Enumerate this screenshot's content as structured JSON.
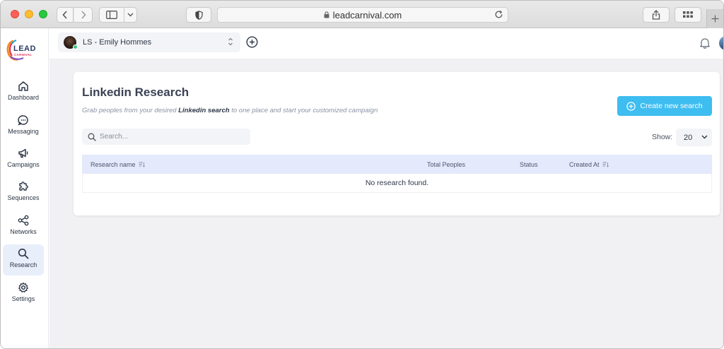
{
  "browser": {
    "url": "leadcarnival.com"
  },
  "logo": {
    "text_top": "LEAD",
    "text_bottom": "CARNIVAL"
  },
  "sidebar": {
    "items": [
      {
        "label": "Dashboard",
        "icon": "home-icon",
        "active": false
      },
      {
        "label": "Messaging",
        "icon": "chat-icon",
        "active": false
      },
      {
        "label": "Campaigns",
        "icon": "megaphone-icon",
        "active": false
      },
      {
        "label": "Sequences",
        "icon": "puzzle-icon",
        "active": false
      },
      {
        "label": "Networks",
        "icon": "share-icon",
        "active": false
      },
      {
        "label": "Research",
        "icon": "search-icon",
        "active": true
      },
      {
        "label": "Settings",
        "icon": "gear-icon",
        "active": false
      }
    ]
  },
  "header": {
    "account_name": "LS - Emily Hommes"
  },
  "page": {
    "title": "Linkedin Research",
    "subtitle_before": "Grab peoples from your desired ",
    "subtitle_bold": "Linkedin search",
    "subtitle_after": " to one place and start your customized campaign",
    "create_button": "Create new search",
    "search_placeholder": "Search...",
    "show_label": "Show:",
    "show_value": "20"
  },
  "table": {
    "columns": [
      "Research name",
      "Total Peoples",
      "Status",
      "Created At"
    ],
    "empty_message": "No research found."
  },
  "colors": {
    "accent": "#3ebdf0",
    "active_nav_bg": "#e9eefb",
    "table_header_bg": "#e4e9fb",
    "page_bg": "#f1f1f4"
  }
}
